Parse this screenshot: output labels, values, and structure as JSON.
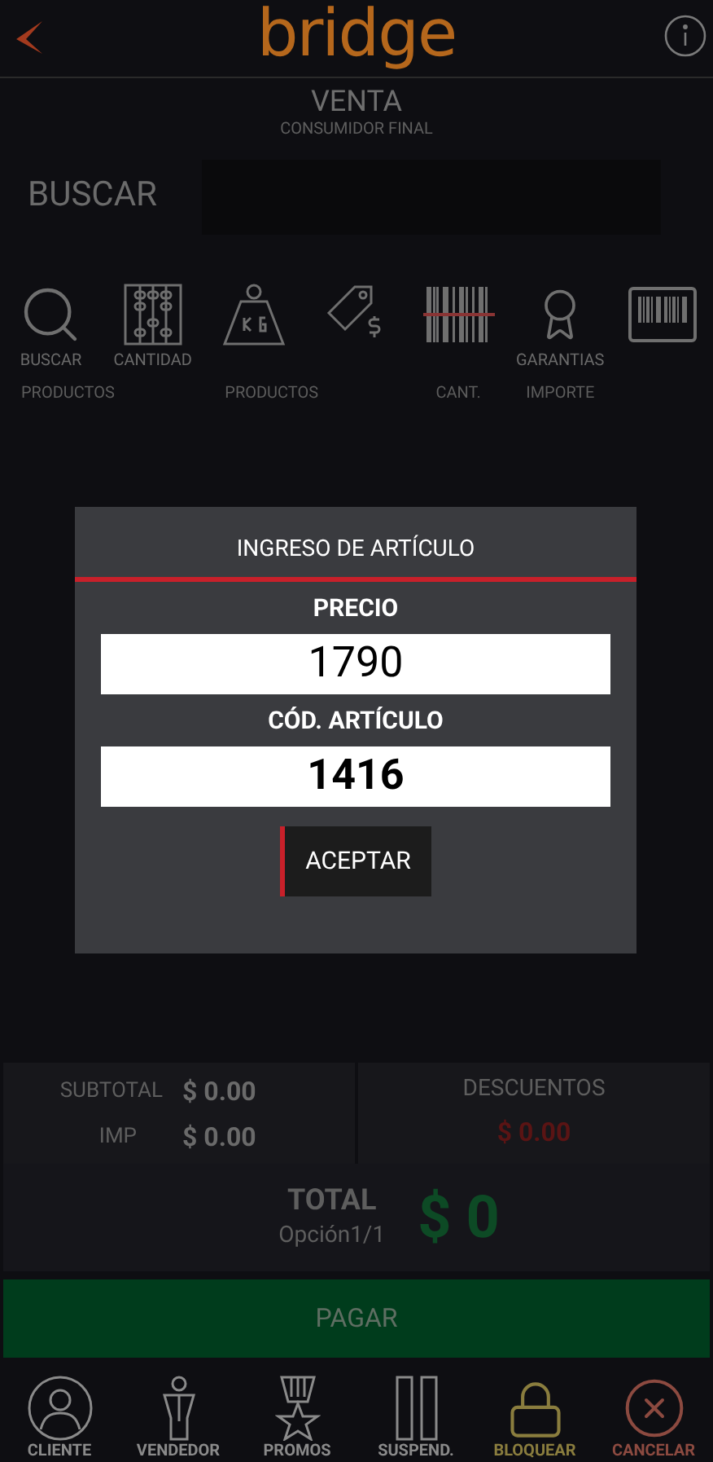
{
  "header": {
    "logo": "bridge",
    "title": "VENTA",
    "subtitle": "CONSUMIDOR FINAL"
  },
  "search": {
    "label": "BUSCAR"
  },
  "tool_captions": [
    "BUSCAR",
    "CANTIDAD",
    "GARANTIAS"
  ],
  "tool_groups": [
    {
      "label": "PRODUCTOS"
    },
    {
      "label": "PRODUCTOS"
    },
    {
      "label": "CANT."
    },
    {
      "label": "IMPORTE"
    }
  ],
  "dialog": {
    "title": "INGRESO DE ARTÍCULO",
    "fields": [
      {
        "label": "PRECIO",
        "value": "1790",
        "bold": false
      },
      {
        "label": "CÓD. ARTÍCULO",
        "value": "1416",
        "bold": true
      }
    ],
    "button": "ACEPTAR"
  },
  "summary": {
    "subtotal_label": "SUBTOTAL",
    "subtotal": "$ 0.00",
    "tax_label": "IMP",
    "tax": "$ 0.00",
    "discounts_label": "DESCUENTOS",
    "discounts": "$ 0.00"
  },
  "total": {
    "label": "TOTAL",
    "option": "Opción1/1",
    "amount": "$ 0"
  },
  "pay_button": "PAGAR",
  "nav": [
    {
      "label": "CLIENTE",
      "color": "#8a8a8a"
    },
    {
      "label": "VENDEDOR",
      "color": "#8a8a8a"
    },
    {
      "label": "PROMOS",
      "color": "#8a8a8a"
    },
    {
      "label": "SUSPEND.",
      "color": "#8a8a8a"
    },
    {
      "label": "BLOQUEAR",
      "color": "#8a7d3e"
    },
    {
      "label": "CANCELAR",
      "color": "#8c4a40"
    }
  ]
}
